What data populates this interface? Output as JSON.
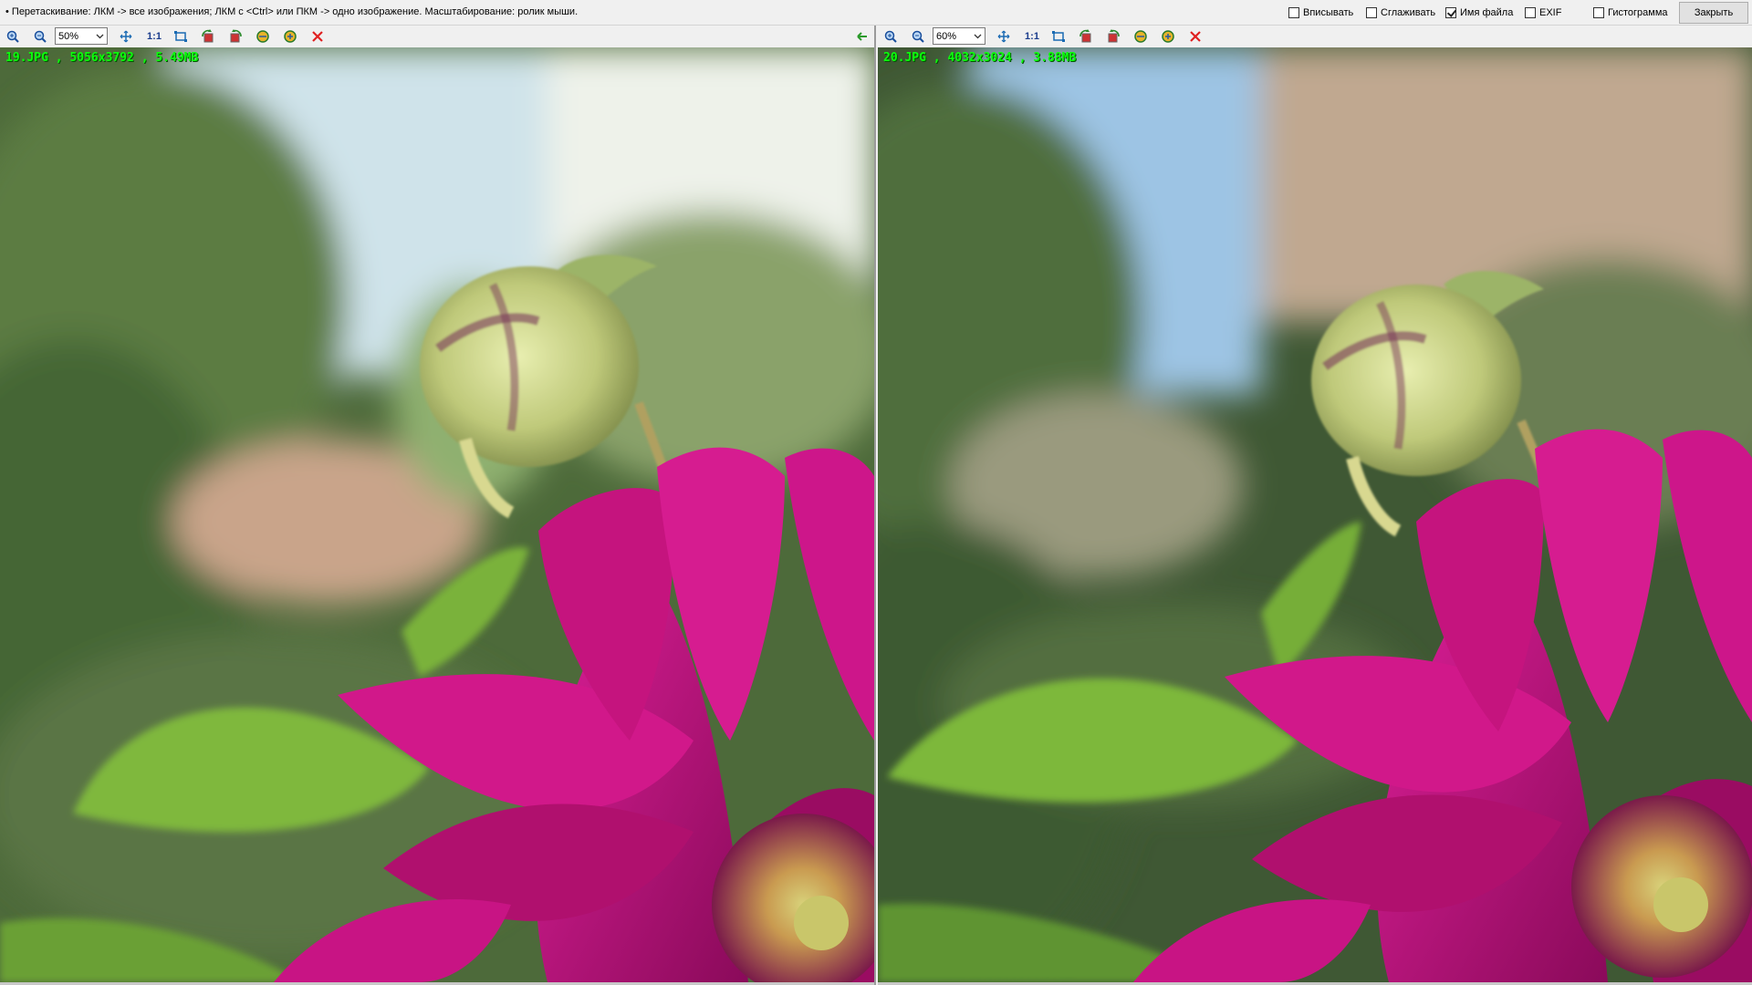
{
  "topbar": {
    "hint": "• Перетаскивание: ЛКМ -> все изображения; ЛКМ с <Ctrl> или ПКМ -> одно изображение. Масштабирование: ролик мыши.",
    "options": [
      {
        "label": "Вписывать",
        "checked": false
      },
      {
        "label": "Сглаживать",
        "checked": false
      },
      {
        "label": "Имя файла",
        "checked": true
      },
      {
        "label": "EXIF",
        "checked": false
      },
      {
        "label": "Гистограмма",
        "checked": false
      }
    ],
    "close_label": "Закрыть"
  },
  "panes": [
    {
      "zoom": "50%",
      "fileinfo": "19.JPG , 5056x3792 , 5.49MB",
      "icons": [
        "zoom-in-icon",
        "zoom-out-icon",
        "fit-icon",
        "actual-size-icon",
        "crop-icon",
        "rotate-left-icon",
        "rotate-right-icon",
        "flip-icon",
        "save-icon",
        "close-icon",
        "sync-arrow-icon"
      ]
    },
    {
      "zoom": "60%",
      "fileinfo": "20.JPG , 4032x3024 , 3.88MB",
      "icons": [
        "zoom-in-icon",
        "zoom-out-icon",
        "fit-icon",
        "actual-size-icon",
        "crop-icon",
        "rotate-left-icon",
        "rotate-right-icon",
        "flip-icon",
        "save-icon",
        "close-icon"
      ]
    }
  ],
  "colors": {
    "info_text": "#0cff0c",
    "close_x": "#e02020",
    "petal": "#c0147a",
    "leaf": "#7ab83a"
  }
}
